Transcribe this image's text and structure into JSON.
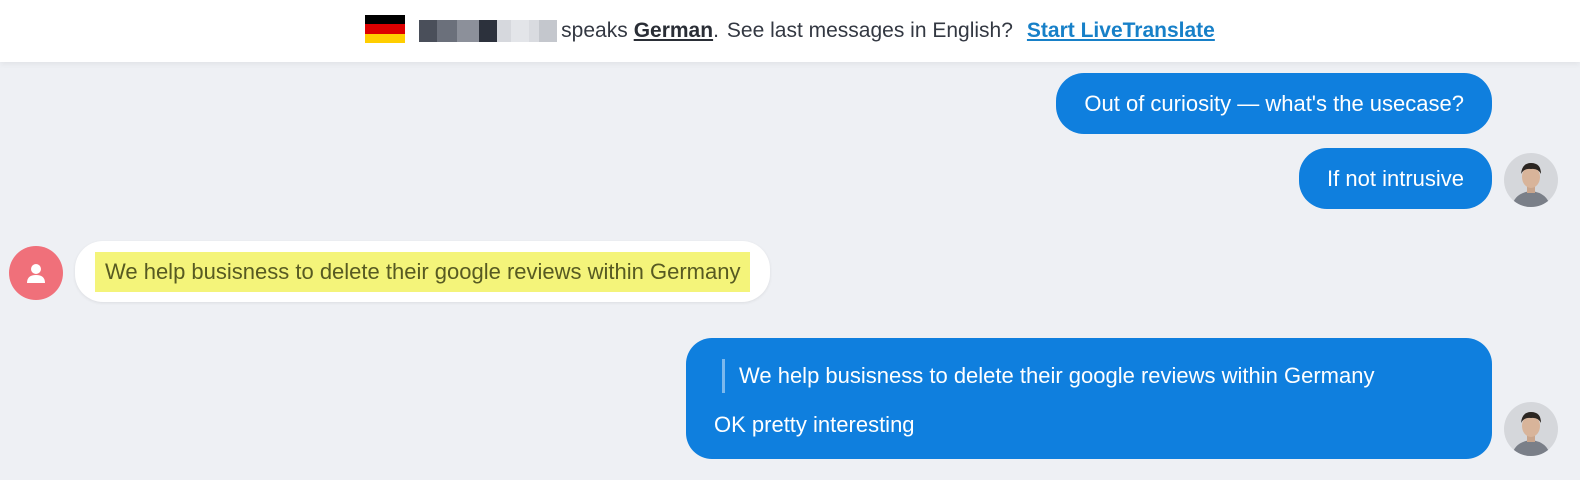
{
  "banner": {
    "speaks": "speaks",
    "language": "German",
    "prompt": "See last messages in English?",
    "action": "Start LiveTranslate"
  },
  "messages": [
    {
      "direction": "outgoing",
      "text": "Out of curiosity — what's the usecase?"
    },
    {
      "direction": "outgoing",
      "text": "If not intrusive"
    },
    {
      "direction": "incoming",
      "text": "We help busisness to delete their google reviews within Germany",
      "highlighted": true
    },
    {
      "direction": "outgoing",
      "quote": "We help busisness to delete their google reviews within Germany",
      "text": "OK pretty interesting"
    }
  ],
  "colors": {
    "outgoing_bubble": "#0f7fde",
    "incoming_bubble": "#ffffff",
    "highlight": "#f4f47a",
    "link": "#1780c8",
    "background": "#eef0f4"
  },
  "icons": {
    "flag": "germany-flag-icon",
    "contact_avatar": "default-user-icon",
    "my_avatar": "user-photo-avatar"
  }
}
